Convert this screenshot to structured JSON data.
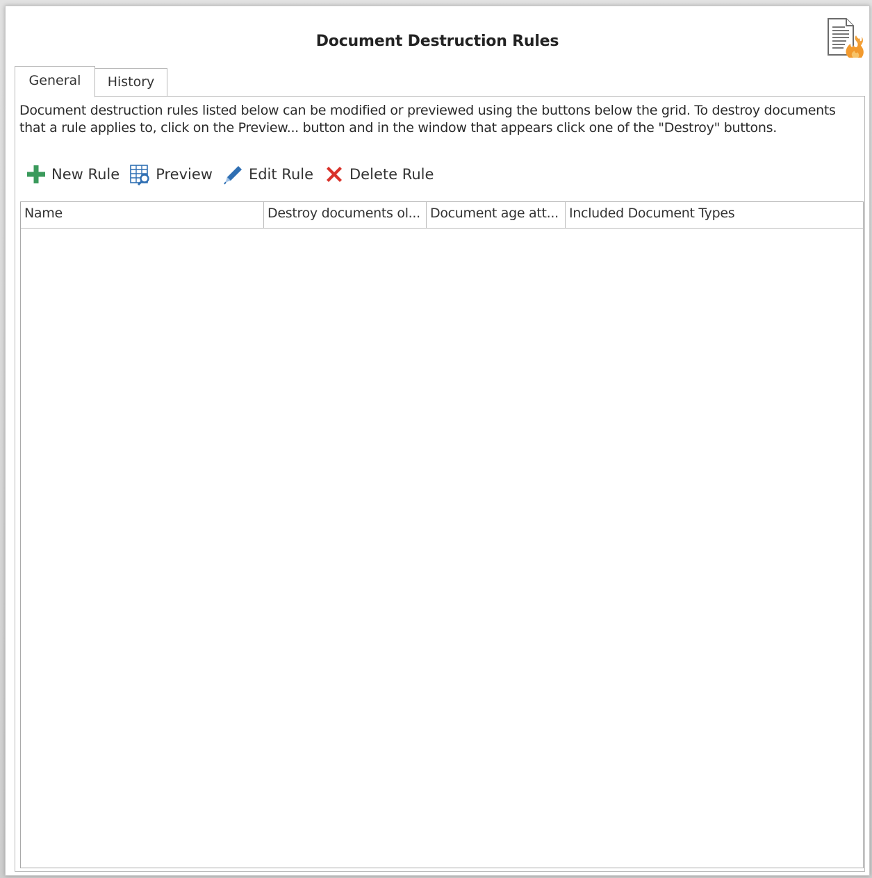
{
  "window": {
    "title": "Document Destruction Rules",
    "title_icon": "document-fire-icon"
  },
  "tabs": [
    {
      "label": "General",
      "active": true
    },
    {
      "label": "History",
      "active": false
    }
  ],
  "general": {
    "description": "Document destruction rules listed below can be modified or previewed using the buttons below the grid.  To destroy documents that a rule applies to, click on the Preview... button and in the window that appears click one of the \"Destroy\" buttons.",
    "toolbar": {
      "new_rule": {
        "label": "New Rule",
        "icon": "plus-icon",
        "color": "#3a9a5b"
      },
      "preview": {
        "label": "Preview",
        "icon": "table-search-icon",
        "color": "#2f6fb3"
      },
      "edit_rule": {
        "label": "Edit Rule",
        "icon": "pencil-icon",
        "color": "#2f6fb3"
      },
      "delete_rule": {
        "label": "Delete Rule",
        "icon": "red-x-icon",
        "color": "#d9322a"
      }
    },
    "grid": {
      "columns": [
        "Name",
        "Destroy documents ol...",
        "Document age att...",
        "Included Document Types"
      ],
      "rows": []
    }
  }
}
